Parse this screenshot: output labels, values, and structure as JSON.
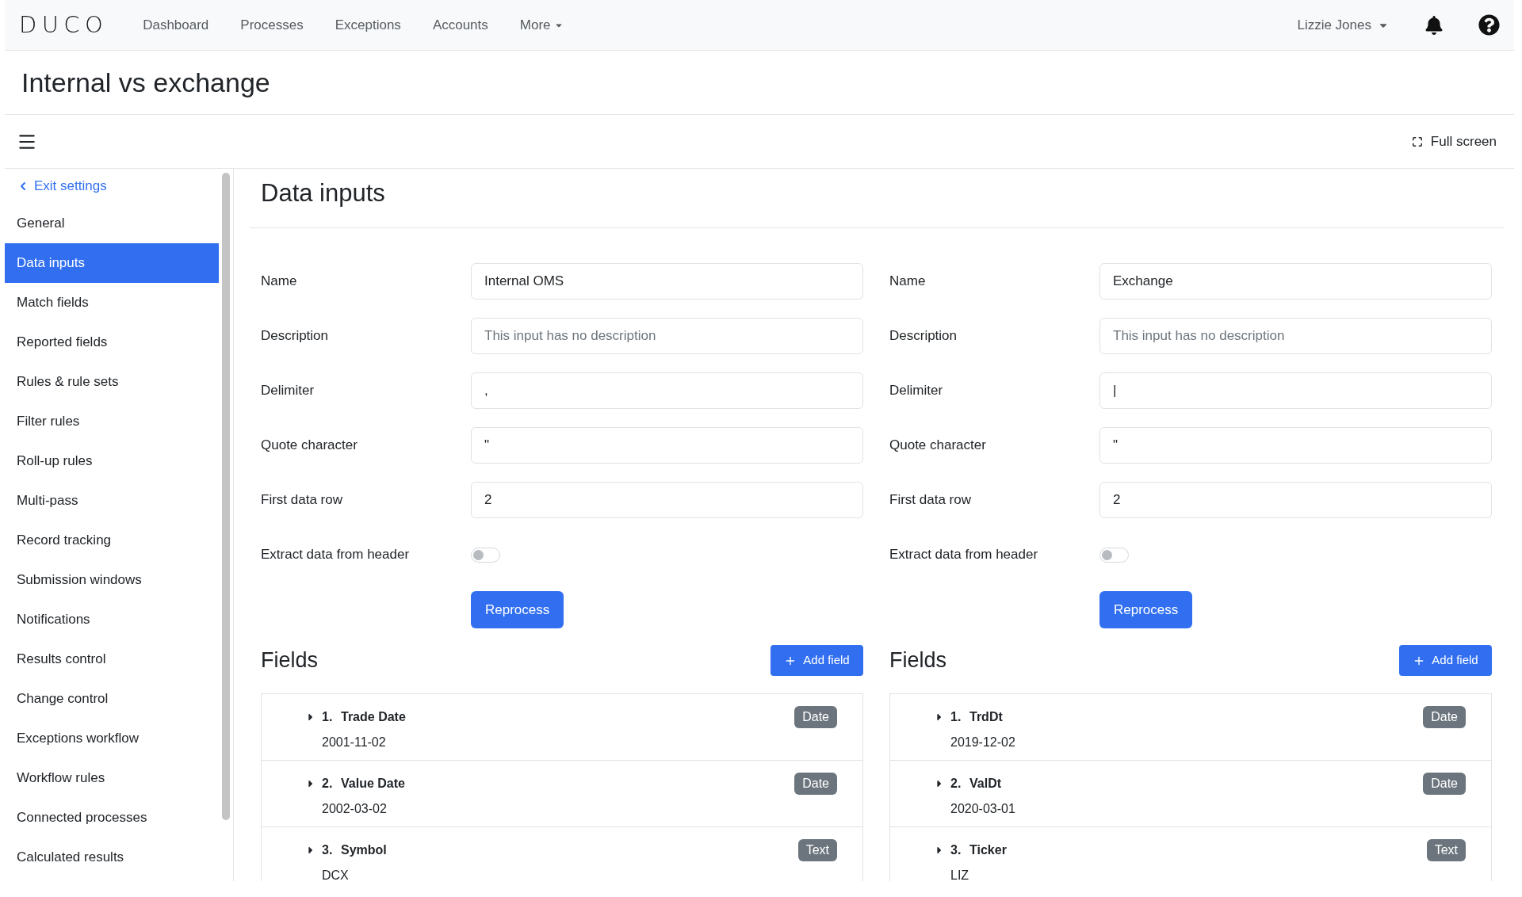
{
  "navbar": {
    "logo": "DUCO",
    "items": [
      {
        "label": "Dashboard",
        "kind": "link"
      },
      {
        "label": "Processes",
        "kind": "link"
      },
      {
        "label": "Exceptions",
        "kind": "link"
      },
      {
        "label": "Accounts",
        "kind": "link"
      },
      {
        "label": "More",
        "kind": "dropdown"
      }
    ],
    "user": "Lizzie Jones"
  },
  "page_title": "Internal vs exchange",
  "toolbar": {
    "full_screen": "Full screen"
  },
  "sidebar": {
    "back_link": "Exit settings",
    "items": [
      {
        "label": "General",
        "selected": false
      },
      {
        "label": "Data inputs",
        "selected": true
      },
      {
        "label": "Match fields",
        "selected": false
      },
      {
        "label": "Reported fields",
        "selected": false
      },
      {
        "label": "Rules & rule sets",
        "selected": false
      },
      {
        "label": "Filter rules",
        "selected": false
      },
      {
        "label": "Roll-up rules",
        "selected": false
      },
      {
        "label": "Multi-pass",
        "selected": false
      },
      {
        "label": "Record tracking",
        "selected": false
      },
      {
        "label": "Submission windows",
        "selected": false
      },
      {
        "label": "Notifications",
        "selected": false
      },
      {
        "label": "Results control",
        "selected": false
      },
      {
        "label": "Change control",
        "selected": false
      },
      {
        "label": "Exceptions workflow",
        "selected": false
      },
      {
        "label": "Workflow rules",
        "selected": false
      },
      {
        "label": "Connected processes",
        "selected": false
      },
      {
        "label": "Calculated results",
        "selected": false
      }
    ]
  },
  "content": {
    "title": "Data inputs",
    "inputs": [
      {
        "form": [
          {
            "label": "Name",
            "kind": "text",
            "value": "Internal OMS"
          },
          {
            "label": "Description",
            "kind": "text",
            "placeholder": "This input has no description"
          },
          {
            "label": "Delimiter",
            "kind": "text",
            "value": ","
          },
          {
            "label": "Quote character",
            "kind": "text",
            "value": "\""
          },
          {
            "label": "First data row",
            "kind": "text",
            "value": "2"
          },
          {
            "label": "Extract data from header",
            "kind": "toggle",
            "on": false
          }
        ],
        "reprocess_button": "Reprocess",
        "fields_title": "Fields",
        "add_field_button": "Add field",
        "fields": [
          {
            "number": "1.",
            "name": "Trade Date",
            "sample": "2001-11-02",
            "type": "Date",
            "expanded": false
          },
          {
            "number": "2.",
            "name": "Value Date",
            "sample": "2002-03-02",
            "type": "Date",
            "expanded": false
          },
          {
            "number": "3.",
            "name": "Symbol",
            "sample": "DCX",
            "type": "Text",
            "expanded": false
          }
        ]
      },
      {
        "form": [
          {
            "label": "Name",
            "kind": "text",
            "value": "Exchange"
          },
          {
            "label": "Description",
            "kind": "text",
            "placeholder": "This input has no description"
          },
          {
            "label": "Delimiter",
            "kind": "text",
            "value": "|"
          },
          {
            "label": "Quote character",
            "kind": "text",
            "value": "\""
          },
          {
            "label": "First data row",
            "kind": "text",
            "value": "2"
          },
          {
            "label": "Extract data from header",
            "kind": "toggle",
            "on": false
          }
        ],
        "reprocess_button": "Reprocess",
        "fields_title": "Fields",
        "add_field_button": "Add field",
        "fields": [
          {
            "number": "1.",
            "name": "TrdDt",
            "sample": "2019-12-02",
            "type": "Date",
            "expanded": false
          },
          {
            "number": "2.",
            "name": "ValDt",
            "sample": "2020-03-01",
            "type": "Date",
            "expanded": false
          },
          {
            "number": "3.",
            "name": "Ticker",
            "sample": "LIZ",
            "type": "Text",
            "expanded": false
          }
        ]
      }
    ]
  }
}
